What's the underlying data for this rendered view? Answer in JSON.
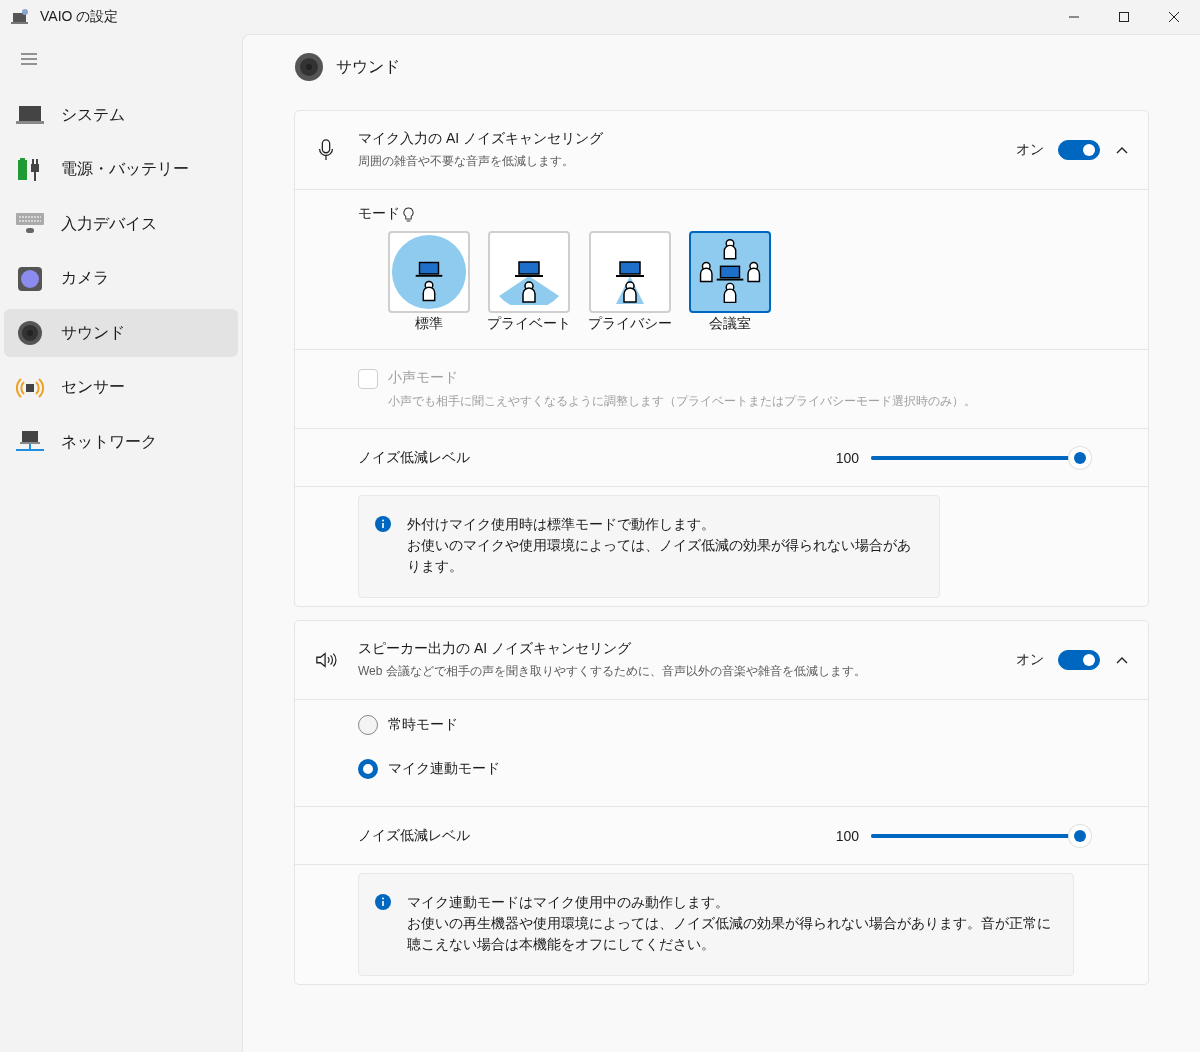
{
  "window": {
    "title": "VAIO の設定"
  },
  "sidebar": {
    "items": [
      {
        "label": "システム",
        "kind": "system",
        "selected": false
      },
      {
        "label": "電源・バッテリー",
        "kind": "power",
        "selected": false
      },
      {
        "label": "入力デバイス",
        "kind": "input",
        "selected": false
      },
      {
        "label": "カメラ",
        "kind": "camera",
        "selected": false
      },
      {
        "label": "サウンド",
        "kind": "sound",
        "selected": true
      },
      {
        "label": "センサー",
        "kind": "sensor",
        "selected": false
      },
      {
        "label": "ネットワーク",
        "kind": "network",
        "selected": false
      }
    ]
  },
  "page": {
    "title": "サウンド"
  },
  "mic_section": {
    "title": "マイク入力の AI ノイズキャンセリング",
    "description": "周囲の雑音や不要な音声を低減します。",
    "toggle": {
      "label": "オン",
      "on": true
    },
    "expanded": true,
    "mode_label": "モード",
    "modes": [
      {
        "label": "標準",
        "kind": "standard",
        "selected": false
      },
      {
        "label": "プライベート",
        "kind": "private",
        "selected": false
      },
      {
        "label": "プライバシー",
        "kind": "privacy",
        "selected": false
      },
      {
        "label": "会議室",
        "kind": "conference",
        "selected": true
      }
    ],
    "whisper": {
      "label": "小声モード",
      "description": "小声でも相手に聞こえやすくなるように調整します（プライベートまたはプライバシーモード選択時のみ）。",
      "checked": false,
      "disabled": true
    },
    "noise_level": {
      "label": "ノイズ低減レベル",
      "reading": "100",
      "level": 1
    },
    "info": [
      "外付けマイク使用時は標準モードで動作します。",
      "お使いのマイクや使用環境によっては、ノイズ低減の効果が得られない場合があります。"
    ]
  },
  "speaker_section": {
    "title": "スピーカー出力の AI ノイズキャンセリング",
    "description": "Web 会議などで相手の声を聞き取りやすくするために、音声以外の音楽や雑音を低減します。",
    "toggle": {
      "label": "オン",
      "on": true
    },
    "expanded": true,
    "options": [
      {
        "label": "常時モード",
        "selected": false
      },
      {
        "label": "マイク連動モード",
        "selected": true
      }
    ],
    "noise_level": {
      "label": "ノイズ低減レベル",
      "reading": "100",
      "level": 1
    },
    "info": [
      "マイク連動モードはマイク使用中のみ動作します。",
      "お使いの再生機器や使用環境によっては、ノイズ低減の効果が得られない場合があります。音が正常に聴こえない場合は本機能をオフにしてください。"
    ]
  }
}
